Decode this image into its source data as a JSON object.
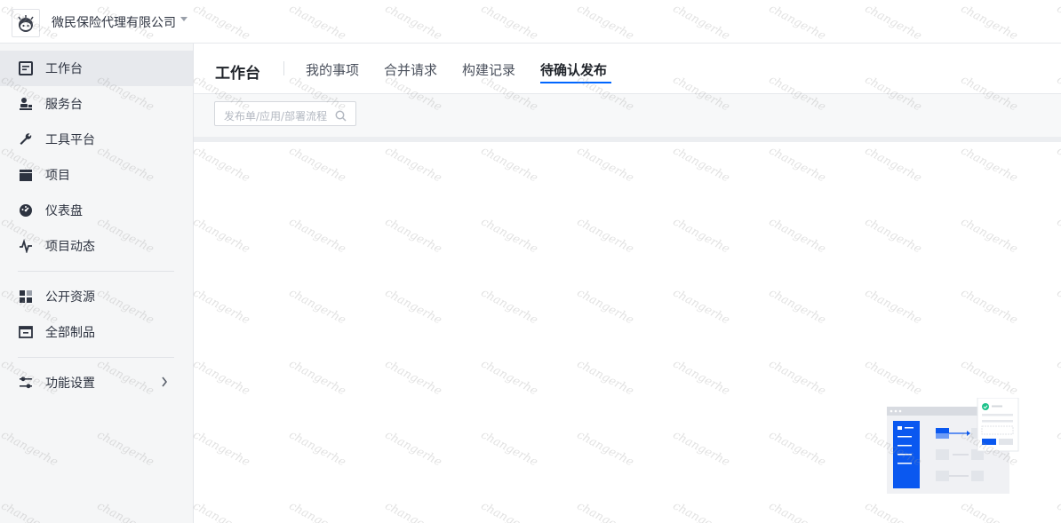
{
  "company": {
    "name": "微民保险代理有限公司"
  },
  "sidebar": {
    "items": [
      {
        "label": "工作台",
        "icon": "workbench-icon",
        "active": true
      },
      {
        "label": "服务台",
        "icon": "service-desk-icon"
      },
      {
        "label": "工具平台",
        "icon": "wrench-icon"
      },
      {
        "label": "项目",
        "icon": "folder-icon"
      },
      {
        "label": "仪表盘",
        "icon": "dashboard-icon"
      },
      {
        "label": "项目动态",
        "icon": "activity-icon"
      },
      {
        "label": "公开资源",
        "icon": "resources-icon"
      },
      {
        "label": "全部制品",
        "icon": "artifact-icon"
      },
      {
        "label": "功能设置",
        "icon": "settings-icon"
      }
    ]
  },
  "header": {
    "title": "工作台",
    "tabs": [
      {
        "label": "我的事项"
      },
      {
        "label": "合并请求"
      },
      {
        "label": "构建记录"
      },
      {
        "label": "待确认发布",
        "active": true
      }
    ]
  },
  "search": {
    "placeholder": "发布单/应用/部署流程"
  },
  "watermark": {
    "text": "changerhe"
  },
  "colors": {
    "accent": "#0066ff",
    "sidebar_bg": "#f5f6f7",
    "active_item_bg": "#e7e9ed"
  }
}
